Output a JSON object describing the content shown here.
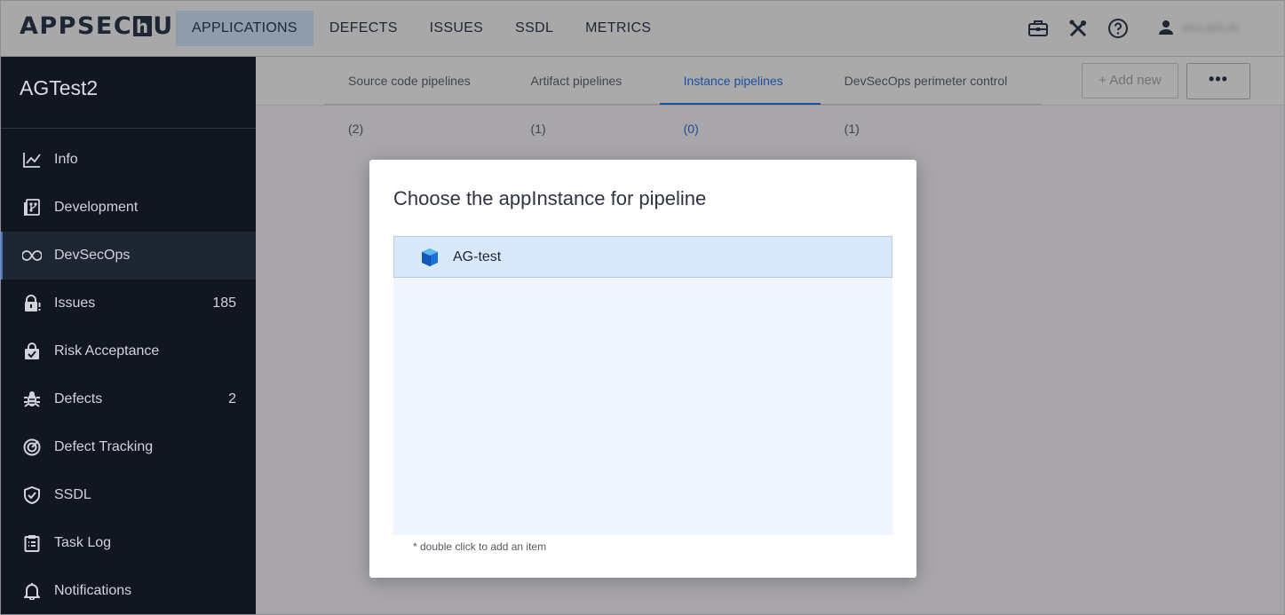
{
  "brand": {
    "logo_left": "APPSEC",
    "logo_h": "h",
    "logo_right": "UB"
  },
  "topnav": {
    "items": [
      {
        "label": "APPLICATIONS",
        "active": true
      },
      {
        "label": "DEFECTS"
      },
      {
        "label": "ISSUES"
      },
      {
        "label": "SSDL"
      },
      {
        "label": "METRICS"
      }
    ],
    "icons": [
      "briefcase-icon",
      "tools-icon",
      "help-icon",
      "user-icon"
    ],
    "user_name": "AGLADLIN"
  },
  "sidebar": {
    "app_title": "AGTest2",
    "items": [
      {
        "label": "Info",
        "icon": "chart-line-icon"
      },
      {
        "label": "Development",
        "icon": "git-branch-icon"
      },
      {
        "label": "DevSecOps",
        "icon": "infinity-icon",
        "active": true
      },
      {
        "label": "Issues",
        "icon": "lock-icon",
        "count": "185"
      },
      {
        "label": "Risk Acceptance",
        "icon": "shopping-bag-check-icon"
      },
      {
        "label": "Defects",
        "icon": "bug-icon",
        "count": "2"
      },
      {
        "label": "Defect Tracking",
        "icon": "target-icon"
      },
      {
        "label": "SSDL",
        "icon": "shield-check-icon"
      },
      {
        "label": "Task Log",
        "icon": "clipboard-icon"
      },
      {
        "label": "Notifications",
        "icon": "bell-icon"
      }
    ]
  },
  "tabs": [
    {
      "label": "Source code pipelines (2)"
    },
    {
      "label": "Artifact pipelines (1)"
    },
    {
      "label": "Instance pipelines (0)",
      "active": true
    },
    {
      "label": "DevSecOps perimeter control (1)"
    }
  ],
  "actions": {
    "add_new": "+ Add new",
    "more": "•••"
  },
  "modal": {
    "title": "Choose the appInstance for pipeline",
    "items": [
      {
        "label": "AG-test",
        "icon": "cube-icon",
        "selected": true
      }
    ],
    "hint": "* double click to add an item"
  },
  "colors": {
    "accent": "#1a4f9e",
    "sidebar_bg": "#111620",
    "selected_row": "#d9e8fb"
  }
}
